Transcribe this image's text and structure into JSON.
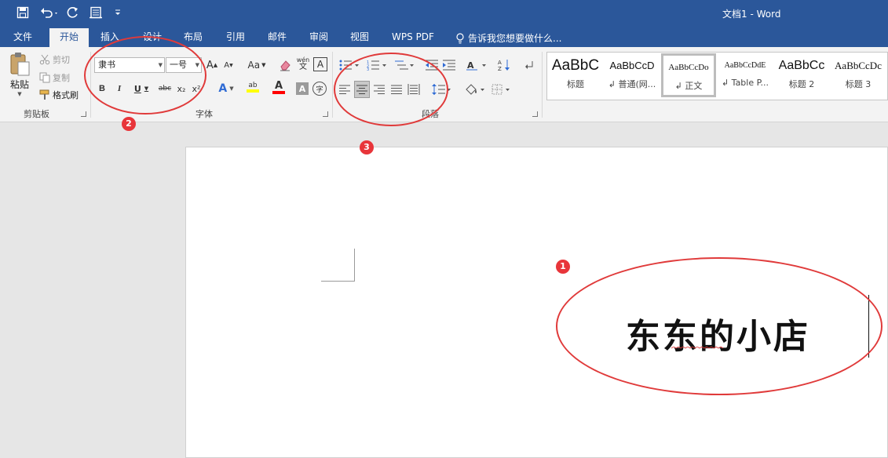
{
  "title_bar": {
    "document_title": "文档1 - Word"
  },
  "tabs": [
    {
      "label": "文件",
      "active": false
    },
    {
      "label": "开始",
      "active": true
    },
    {
      "label": "插入",
      "active": false
    },
    {
      "label": "设计",
      "active": false
    },
    {
      "label": "布局",
      "active": false
    },
    {
      "label": "引用",
      "active": false
    },
    {
      "label": "邮件",
      "active": false
    },
    {
      "label": "审阅",
      "active": false
    },
    {
      "label": "视图",
      "active": false
    },
    {
      "label": "WPS PDF",
      "active": false
    }
  ],
  "tell_me": "告诉我您想要做什么...",
  "clipboard": {
    "group_label": "剪贴板",
    "paste": "粘贴",
    "cut": "剪切",
    "copy": "复制",
    "format_painter": "格式刷"
  },
  "font": {
    "group_label": "字体",
    "font_name": "隶书",
    "font_size": "一号",
    "grow_glyph": "A",
    "shrink_glyph": "A",
    "case_glyph": "Aa",
    "phonetic_glyph": "wén",
    "phonetic_sub": "文",
    "border_glyph": "A",
    "bold": "B",
    "italic": "I",
    "underline": "U",
    "strike": "abc",
    "subscript": "x₂",
    "superscript": "x²",
    "effects_glyph": "A",
    "highlight_glyph": "ab",
    "color_glyph": "A",
    "shading_glyph": "A",
    "encircle_glyph": "字"
  },
  "paragraph": {
    "group_label": "段落"
  },
  "styles": [
    {
      "sample": "AaBbC",
      "name": "标题"
    },
    {
      "sample": "AaBbCcD",
      "name": "↲ 普通(网..."
    },
    {
      "sample": "AaBbCcDo",
      "name": "↲ 正文"
    },
    {
      "sample": "AaBbCcDdE",
      "name": "↲ Table P..."
    },
    {
      "sample": "AaBbCc",
      "name": "标题 2"
    },
    {
      "sample": "AaBbCcDc",
      "name": "标题 3"
    }
  ],
  "annotations": {
    "marker_1": "1",
    "marker_2": "2",
    "marker_3": "3"
  },
  "document": {
    "text": "东东的小店"
  },
  "colors": {
    "title_bar": "#2b579a",
    "annotation_red": "#e03a3a",
    "highlight_yellow": "#ffff00",
    "font_color_red": "#ff0000"
  }
}
